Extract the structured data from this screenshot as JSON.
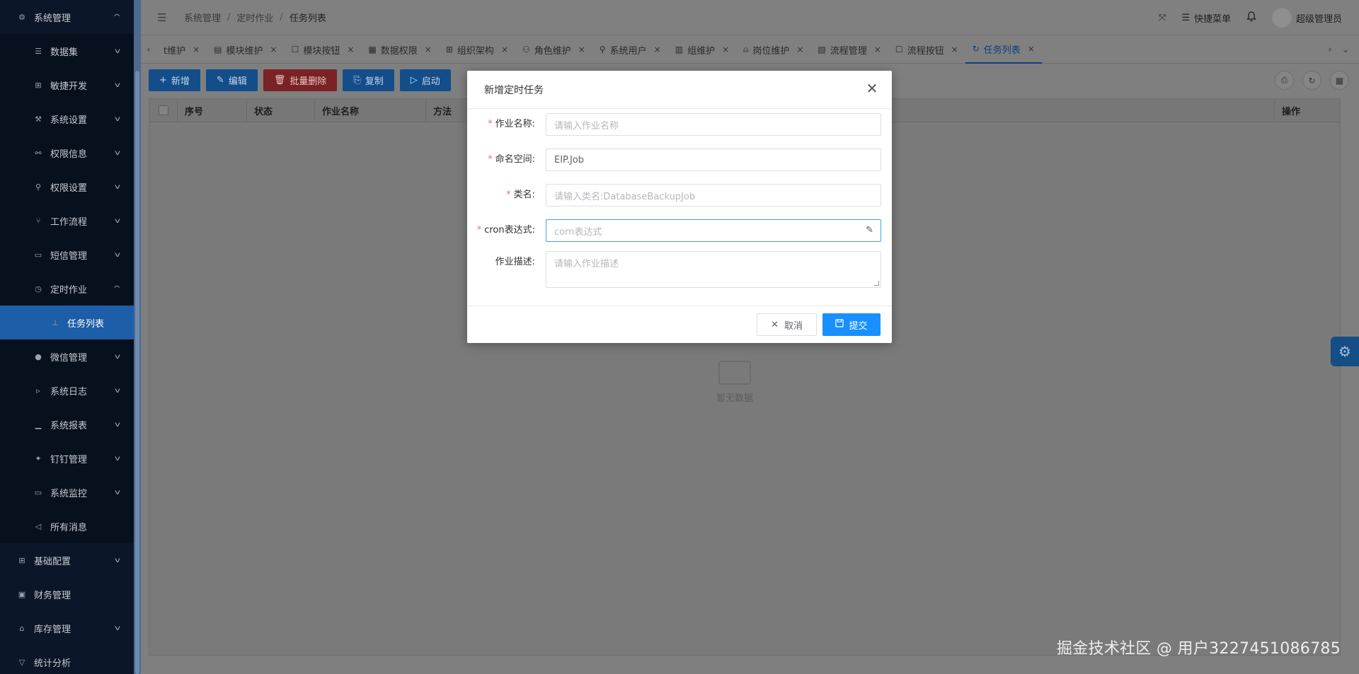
{
  "sidebar": {
    "items": [
      {
        "label": "系统管理",
        "icon": "gear-icon",
        "level": "top",
        "arrow": "up"
      },
      {
        "label": "数据集",
        "icon": "list-icon",
        "level": "sub",
        "arrow": "down"
      },
      {
        "label": "敏捷开发",
        "icon": "grid-icon",
        "level": "sub",
        "arrow": "down"
      },
      {
        "label": "系统设置",
        "icon": "wrench-icon",
        "level": "sub",
        "arrow": "down"
      },
      {
        "label": "权限信息",
        "icon": "link-icon",
        "level": "sub",
        "arrow": "down"
      },
      {
        "label": "权限设置",
        "icon": "user-icon",
        "level": "sub",
        "arrow": "down"
      },
      {
        "label": "工作流程",
        "icon": "branch-icon",
        "level": "sub",
        "arrow": "down"
      },
      {
        "label": "短信管理",
        "icon": "message-icon",
        "level": "sub",
        "arrow": "down"
      },
      {
        "label": "定时作业",
        "icon": "clock-icon",
        "level": "sub",
        "arrow": "up"
      },
      {
        "label": "任务列表",
        "icon": "tasks-icon",
        "level": "sub2",
        "arrow": "",
        "active": true
      },
      {
        "label": "微信管理",
        "icon": "wechat-icon",
        "level": "sub",
        "arrow": "down"
      },
      {
        "label": "系统日志",
        "icon": "terminal-icon",
        "level": "sub",
        "arrow": "down"
      },
      {
        "label": "系统报表",
        "icon": "chart-icon",
        "level": "sub",
        "arrow": "down"
      },
      {
        "label": "钉钉管理",
        "icon": "pin-icon",
        "level": "sub",
        "arrow": "down"
      },
      {
        "label": "系统监控",
        "icon": "monitor-icon",
        "level": "sub",
        "arrow": "down"
      },
      {
        "label": "所有消息",
        "icon": "megaphone-icon",
        "level": "sub",
        "arrow": ""
      },
      {
        "label": "基础配置",
        "icon": "grid-icon",
        "level": "top",
        "arrow": "down"
      },
      {
        "label": "财务管理",
        "icon": "finance-icon",
        "level": "top",
        "arrow": ""
      },
      {
        "label": "库存管理",
        "icon": "bank-icon",
        "level": "top",
        "arrow": "down"
      },
      {
        "label": "统计分析",
        "icon": "filter-icon",
        "level": "top",
        "arrow": ""
      }
    ]
  },
  "header": {
    "breadcrumb": [
      "系统管理",
      "定时作业",
      "任务列表"
    ],
    "quick_menu": "快捷菜单",
    "username": "超级管理员"
  },
  "tabs": [
    {
      "label": "t维护",
      "icon": ""
    },
    {
      "label": "模块维护",
      "icon": "▤"
    },
    {
      "label": "模块按钮",
      "icon": "☐"
    },
    {
      "label": "数据权限",
      "icon": "▦"
    },
    {
      "label": "组织架构",
      "icon": "⊞"
    },
    {
      "label": "角色维护",
      "icon": "⚇"
    },
    {
      "label": "系统用户",
      "icon": "⚲"
    },
    {
      "label": "组维护",
      "icon": "▥"
    },
    {
      "label": "岗位维护",
      "icon": "⍝"
    },
    {
      "label": "流程管理",
      "icon": "▧"
    },
    {
      "label": "流程按钮",
      "icon": "☐"
    },
    {
      "label": "任务列表",
      "icon": "↻",
      "active": true
    }
  ],
  "toolbar": {
    "add": "新增",
    "edit": "编辑",
    "batch_delete": "批量删除",
    "copy": "复制",
    "start": "启动"
  },
  "table": {
    "columns": [
      "序号",
      "状态",
      "作业名称",
      "方法"
    ],
    "action_column": "操作",
    "empty_text": "暂无数据"
  },
  "modal": {
    "title": "新增定时任务",
    "fields": {
      "job_name": {
        "label": "作业名称:",
        "placeholder": "请输入作业名称",
        "required": true
      },
      "namespace": {
        "label": "命名空间:",
        "value": "EIP.Job",
        "required": true
      },
      "class_name": {
        "label": "类名:",
        "placeholder": "请输入类名:DatabaseBackupJob",
        "required": true
      },
      "cron": {
        "label": "cron表达式:",
        "placeholder": "corn表达式",
        "required": true
      },
      "description": {
        "label": "作业描述:",
        "placeholder": "请输入作业描述",
        "required": false
      }
    },
    "cancel": "取消",
    "submit": "提交"
  },
  "watermark": "掘金技术社区 @ 用户3227451086785",
  "colors": {
    "primary": "#1890ff",
    "required": "#f56c6c",
    "sidebar_bg": "#0b1628",
    "active_item": "#1c5ea8"
  }
}
